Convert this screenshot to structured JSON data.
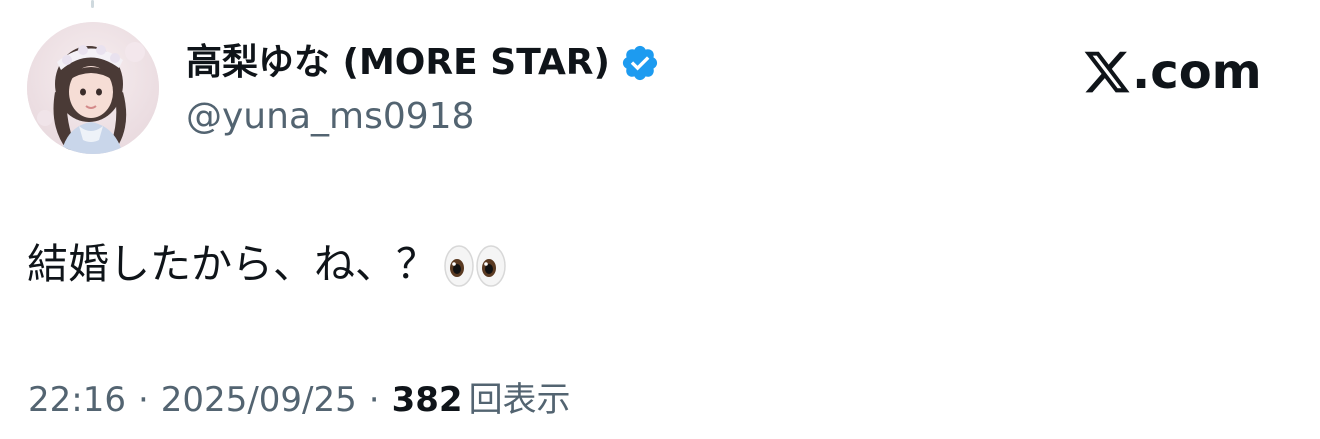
{
  "author": {
    "display_name": "高梨ゆな (MORE STAR)",
    "handle": "@yuna_ms0918",
    "verified": true,
    "verified_color": "#1d9bf0",
    "avatar_icon": "profile-photo"
  },
  "brand": {
    "suffix": ".com",
    "logo_icon": "x-logo-icon"
  },
  "tweet": {
    "text": "結婚したから、ね、？",
    "emoji_icon": "eyes-emoji"
  },
  "meta": {
    "time": "22:16",
    "separator": "·",
    "date": "2025/09/25",
    "view_count": "382",
    "view_label": "回表示"
  },
  "colors": {
    "primary_text": "#0f1419",
    "secondary_text": "#536471",
    "thread_line": "#cfd9de"
  }
}
